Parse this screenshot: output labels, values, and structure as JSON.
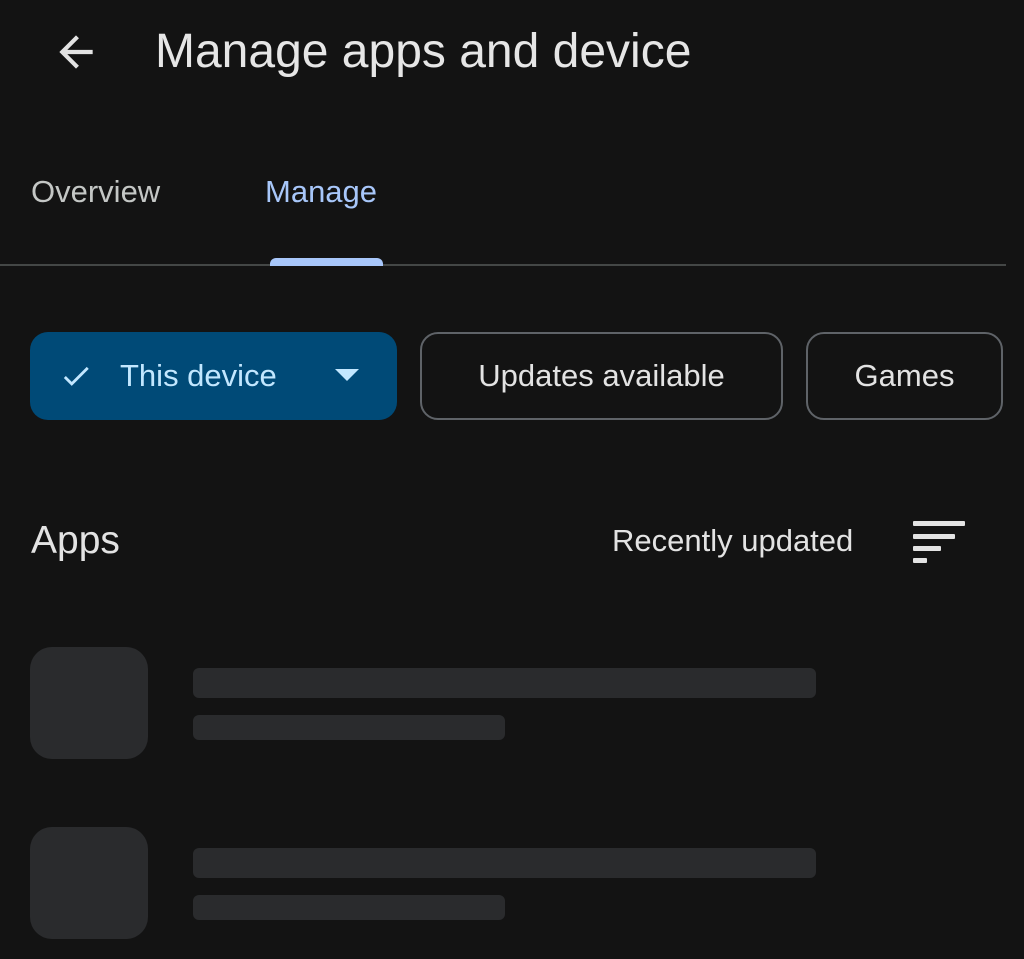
{
  "header": {
    "back_icon": "arrow-left-icon",
    "title": "Manage apps and device"
  },
  "tabs": [
    {
      "label": "Overview",
      "selected": false
    },
    {
      "label": "Manage",
      "selected": true
    }
  ],
  "filters": {
    "device_chip": {
      "label": "This device",
      "icon": "check-icon",
      "dropdown_icon": "caret-down-icon",
      "selected": true
    },
    "updates_chip": {
      "label": "Updates available",
      "selected": false
    },
    "games_chip": {
      "label": "Games",
      "selected": false
    }
  },
  "apps_section": {
    "title": "Apps",
    "sort_label": "Recently updated",
    "sort_icon": "sort-icon"
  },
  "colors": {
    "background": "#131313",
    "accent": "#a8c7fa",
    "selected_chip_bg": "#004a77",
    "selected_chip_text": "#c2e7ff",
    "skeleton": "#2a2b2d"
  }
}
